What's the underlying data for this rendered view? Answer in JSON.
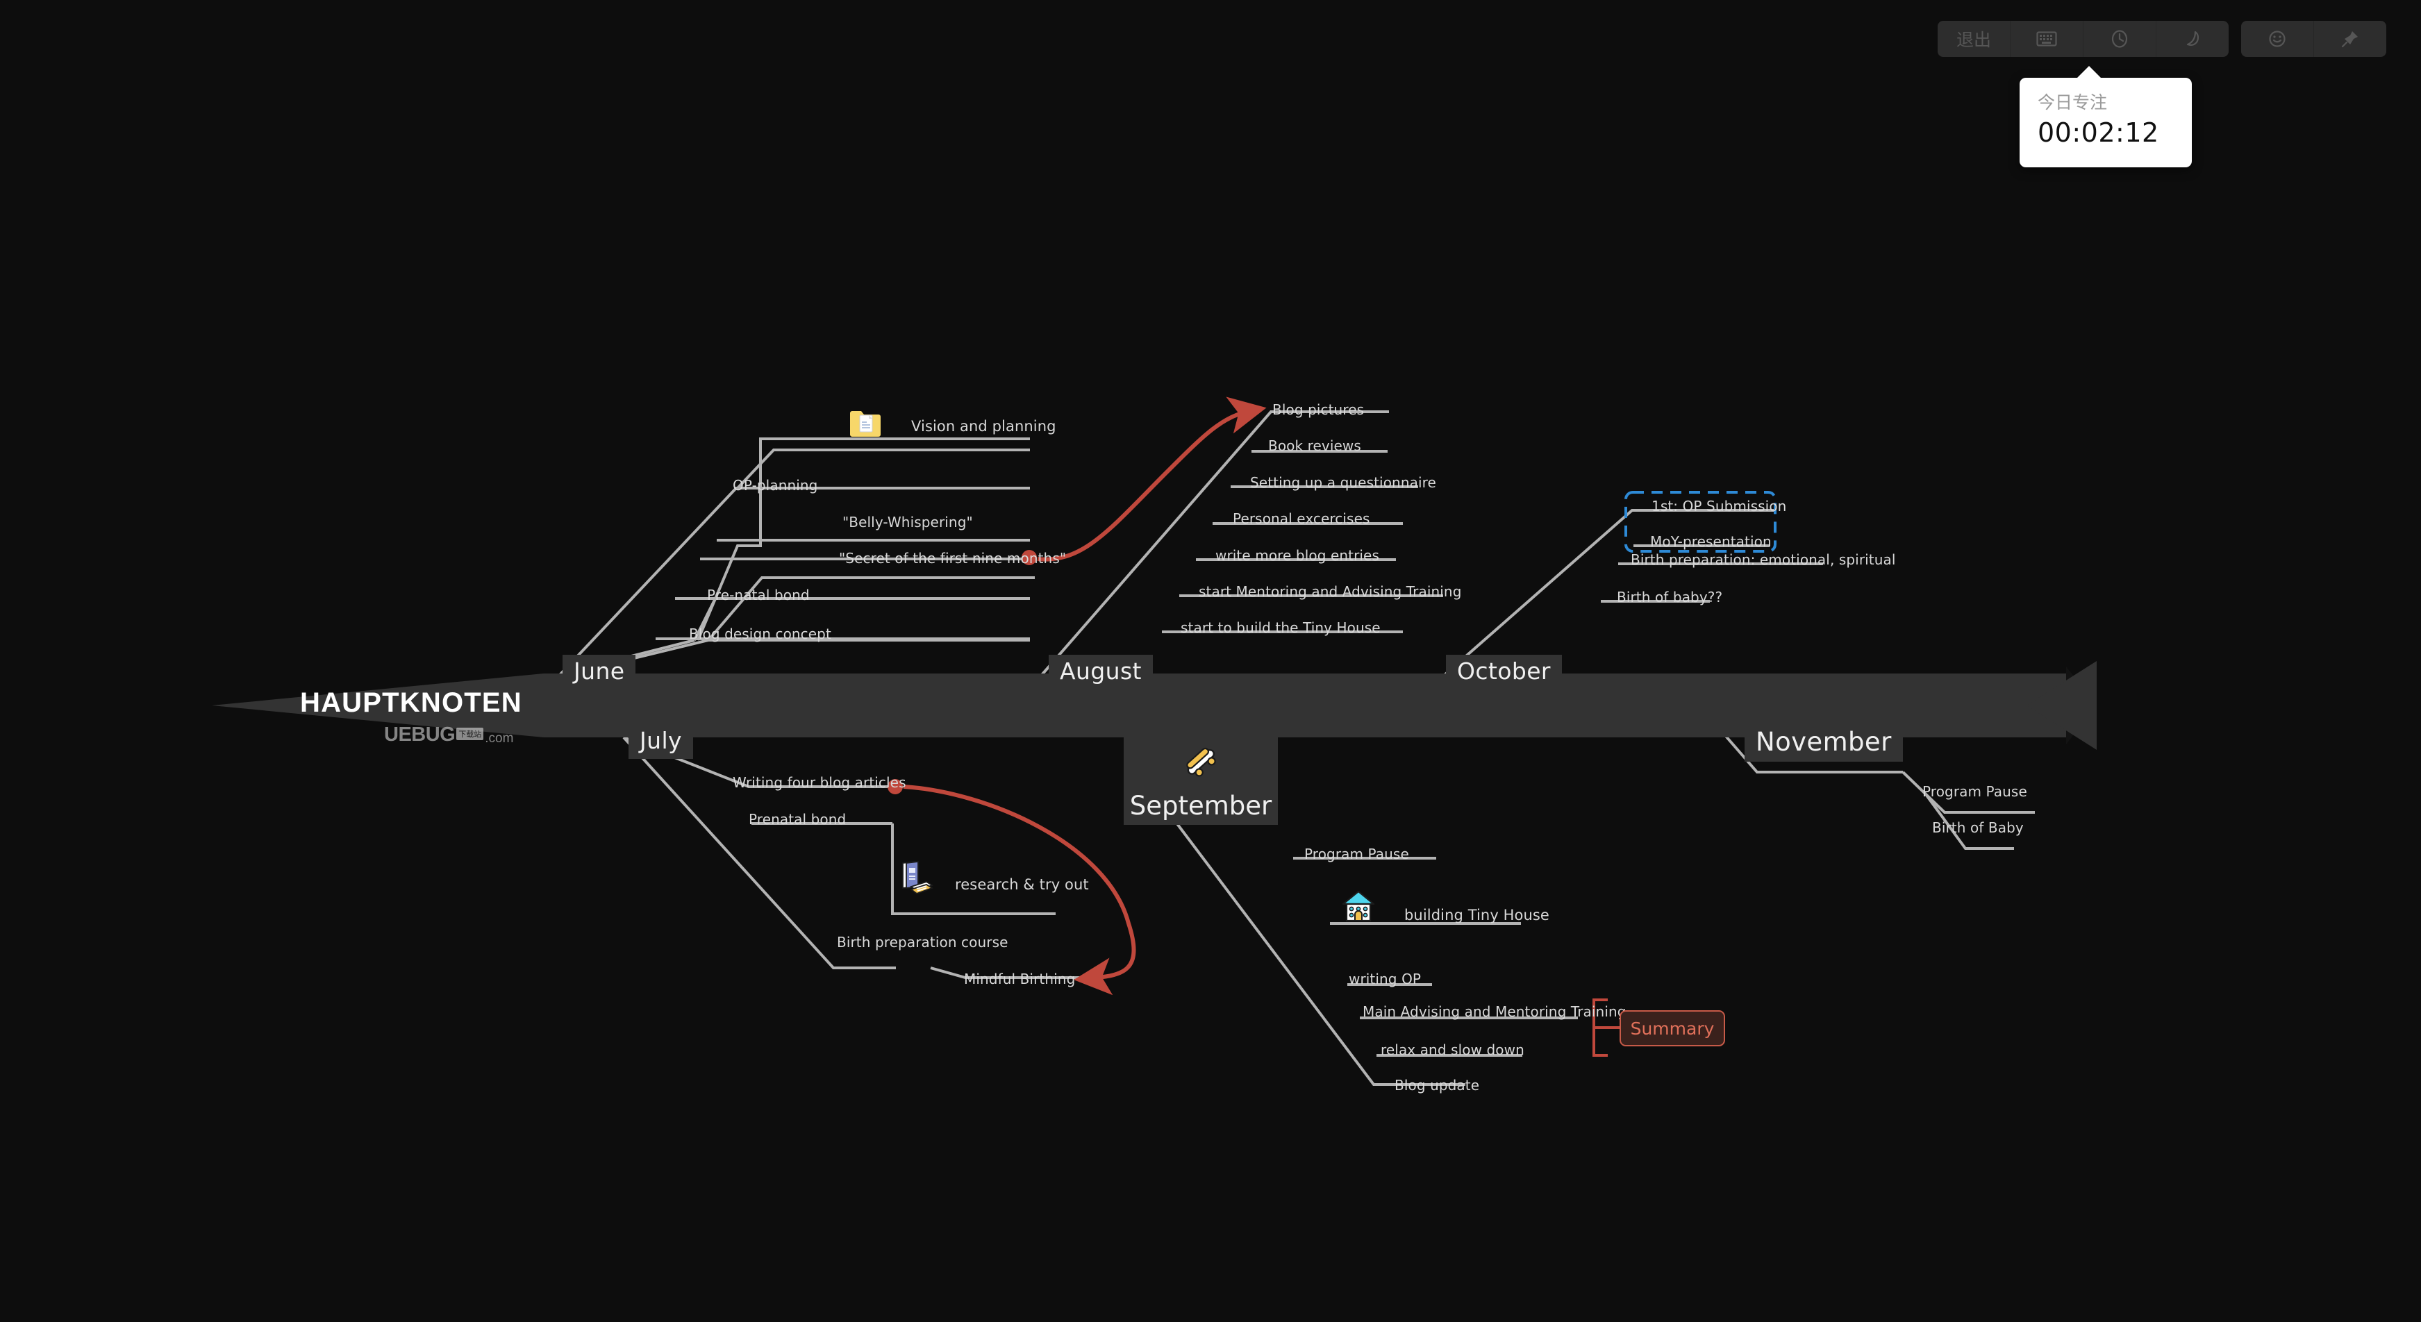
{
  "toolbar": {
    "groups": [
      {
        "name": "main-controls",
        "buttons": [
          {
            "label": "退出",
            "icon": "exit-text"
          },
          {
            "label": "",
            "icon": "keyboard-icon"
          },
          {
            "label": "",
            "icon": "clock-icon"
          },
          {
            "label": "",
            "icon": "moon-icon"
          }
        ]
      },
      {
        "name": "extra-controls",
        "buttons": [
          {
            "label": "",
            "icon": "smiley-icon"
          },
          {
            "label": "",
            "icon": "pin-icon"
          }
        ]
      }
    ]
  },
  "focus_card": {
    "title": "今日专注",
    "time": "00:02:12"
  },
  "diagram": {
    "title": "HAUPTKNOTEN",
    "watermark": {
      "main": "UEBUG",
      "tag": "下载站",
      "com": ".com"
    },
    "accent_red": "#c0483c",
    "accent_blue": "#2e8ad6",
    "spine_color": "#333333",
    "wire_color": "#b3b3b3",
    "months": [
      {
        "label": "June"
      },
      {
        "label": "July"
      },
      {
        "label": "August"
      },
      {
        "label": "September",
        "icon": "skateboard-icon"
      },
      {
        "label": "October"
      },
      {
        "label": "November"
      }
    ],
    "branches": {
      "june": [
        "Vision and planning",
        "OP-planning",
        "\"Belly-Whispering\"",
        "\"Secret of the first nine months\"",
        "Pre-natal bond",
        "Blog design concept"
      ],
      "july": [
        "Writing four blog articles",
        "Prenatal bond",
        "research & try out",
        "Birth preparation course",
        "Mindful Birthing"
      ],
      "august": [
        "Blog pictures",
        "Book reviews",
        "Setting up a questionnaire",
        "Personal excercises",
        "write more blog entries",
        "start Mentoring and Advising Training",
        "start to build the Tiny House"
      ],
      "september": [
        "Program Pause",
        "building Tiny House",
        "writing OP",
        "Main Advising and Mentoring Training",
        "relax and slow down",
        "Blog update"
      ],
      "october": [
        "1st: OP Submission",
        "MoY-presentation",
        "Birth preparation: emotional, spiritual",
        "Birth of baby??"
      ],
      "november": [
        "Program Pause",
        "Birth of Baby"
      ]
    },
    "icons": {
      "vision": "folder-document-icon",
      "research": "books-icon",
      "tiny_house": "house-icon",
      "september": "skateboard-icon"
    },
    "summary_label": "Summary"
  }
}
